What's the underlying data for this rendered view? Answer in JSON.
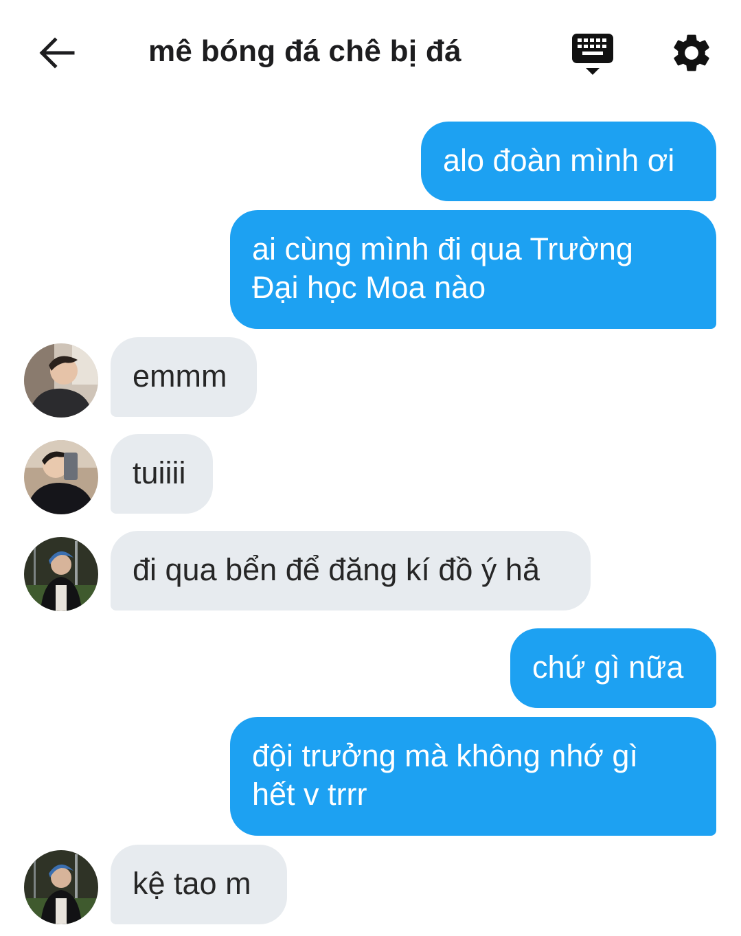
{
  "header": {
    "title": "mê bóng đá chê bị đá",
    "back_icon": "arrow-left-icon",
    "keyboard_icon": "keyboard-icon",
    "settings_icon": "gear-icon"
  },
  "colors": {
    "outgoing_bubble": "#1da1f2",
    "incoming_bubble": "#e7ebef"
  },
  "messages": [
    {
      "direction": "outgoing",
      "text": "alo đoàn mình ơi"
    },
    {
      "direction": "outgoing",
      "lines": [
        "ai cùng mình đi qua Trường",
        "Đại học Moa nào"
      ]
    },
    {
      "direction": "incoming",
      "text": "emmm"
    },
    {
      "direction": "incoming",
      "text": "tuiiii"
    },
    {
      "direction": "incoming",
      "text": "đi qua bển để đăng kí đồ ý hả"
    },
    {
      "direction": "outgoing",
      "text": "chứ gì nữa"
    },
    {
      "direction": "outgoing",
      "lines": [
        "đội trưởng mà không nhớ gì",
        "hết v trrr"
      ]
    },
    {
      "direction": "incoming",
      "text": "kệ tao m"
    }
  ]
}
